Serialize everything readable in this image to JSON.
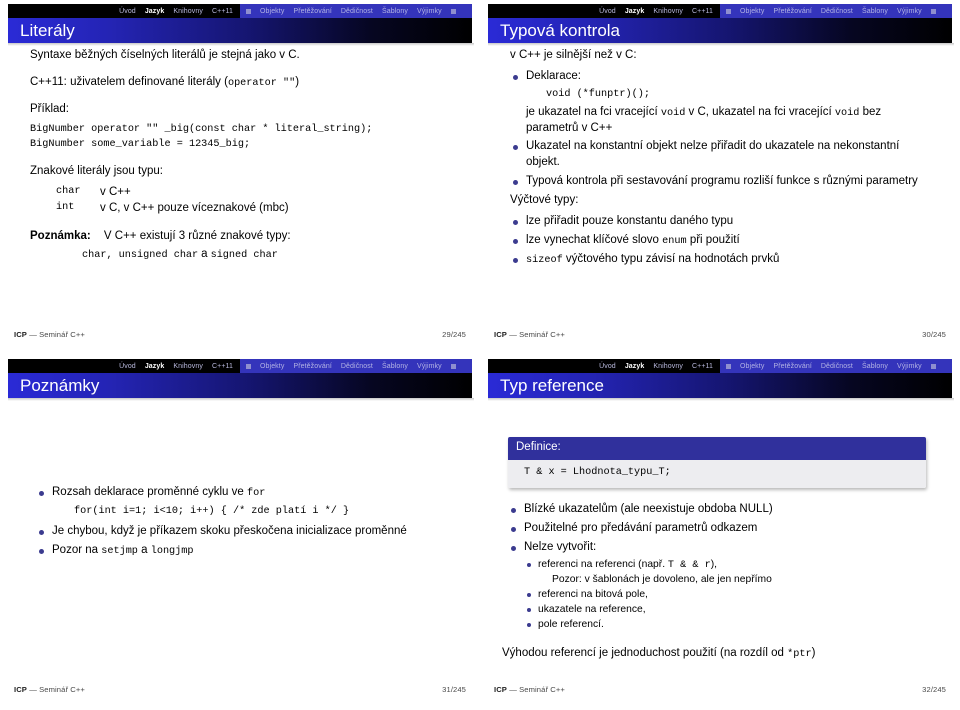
{
  "nav": {
    "left_items": [
      {
        "label": "Úvod",
        "current": false
      },
      {
        "label": "Jazyk",
        "current": true
      },
      {
        "label": "Knihovny",
        "current": false
      },
      {
        "label": "C++11",
        "current": false
      }
    ],
    "right_items": [
      {
        "label": "Objekty"
      },
      {
        "label": "Přetěžování"
      },
      {
        "label": "Dědičnost"
      },
      {
        "label": "Šablony"
      },
      {
        "label": "Výjimky"
      }
    ],
    "prev_icon": "prev-arrow-icon",
    "next_icon": "next-arrow-icon"
  },
  "colors": {
    "nav_blue": "#3434bb",
    "title_blue": "#2a2ad6",
    "bullet": "#3b3b8f",
    "defbox_header": "#30309c",
    "defbox_body": "#ededf0"
  },
  "slide1": {
    "title": "Literály",
    "p1": "Syntaxe běžných číselných literálů je stejná jako v C.",
    "p2_pre": "C++11: uživatelem definované literály (",
    "p2_code": "operator \"\"",
    "p2_post": ")",
    "p3": "Příklad:",
    "code": "BigNumber operator \"\" _big(const char * literal_string);\nBigNumber some_variable = 12345_big;",
    "p4": "Znakové literály jsou typu:",
    "types": [
      {
        "code": "char",
        "text": "v C++"
      },
      {
        "code": "int",
        "text": "v C, v C++ pouze víceznakové (mbc)"
      }
    ],
    "note_label": "Poznámka:",
    "note_text": "V C++ existují 3 různé znakové typy:",
    "note_code_a": "char, unsigned char",
    "note_code_sep": "a",
    "note_code_b": "signed char",
    "footer_org": "ICP",
    "footer_text": "— Seminář C++",
    "page": "29/245"
  },
  "slide2": {
    "title": "Typová kontrola",
    "lead": "v C++ je silnější než v C:",
    "decl_label": "Deklarace:",
    "decl_code": "void (*funptr)();",
    "decl_text_1": "je ukazatel na fci vracející ",
    "decl_code_inline_1": "void",
    "decl_text_2": " v C, ukazatel na fci vracející ",
    "decl_code_inline_2": "void",
    "decl_text_3": " bez parametrů v C++",
    "bullet_2": "Ukazatel na konstantní objekt nelze přiřadit do ukazatele na nekonstantní objekt.",
    "bullet_3": "Typová kontrola při sestavování programu rozliší funkce s různými parametry",
    "enum_lead": "Výčtové typy:",
    "enum_b1": "lze přiřadit pouze konstantu daného typu",
    "enum_b2_pre": "lze vynechat klíčové slovo ",
    "enum_b2_code": "enum",
    "enum_b2_post": " při použití",
    "enum_b3_code": "sizeof",
    "enum_b3_post": " výčtového typu závisí na hodnotách prvků",
    "footer_org": "ICP",
    "footer_text": "— Seminář C++",
    "page": "30/245"
  },
  "slide3": {
    "title": "Poznámky",
    "b1_pre": "Rozsah deklarace proměnné cyklu ve ",
    "b1_code": "for",
    "b1_codeblock": "for(int i=1; i<10; i++) { /* zde platí i */ }",
    "b2": "Je chybou, když je příkazem skoku přeskočena inicializace proměnné",
    "b3_pre": "Pozor na ",
    "b3_code_a": "setjmp",
    "b3_mid": " a ",
    "b3_code_b": "longjmp",
    "footer_org": "ICP",
    "footer_text": "— Seminář C++",
    "page": "31/245"
  },
  "slide4": {
    "title": "Typ reference",
    "def_label": "Definice:",
    "def_code": "T & x = Lhodnota_typu_T;",
    "b1": "Blízké ukazatelům (ale neexistuje obdoba NULL)",
    "b2": "Použitelné pro předávání parametrů odkazem",
    "b3": "Nelze vytvořit:",
    "s1_pre": "referenci na referenci (např. ",
    "s1_code": "T & & r",
    "s1_post": "),",
    "s1_note": "Pozor: v šablonách je dovoleno, ale jen nepřímo",
    "s2": "referenci na bitová pole,",
    "s3": "ukazatele na reference,",
    "s4": "pole referencí.",
    "closing_pre": "Výhodou referencí je jednoduchost použití (na rozdíl od ",
    "closing_code": "*ptr",
    "closing_post": ")",
    "footer_org": "ICP",
    "footer_text": "— Seminář C++",
    "page": "32/245"
  }
}
